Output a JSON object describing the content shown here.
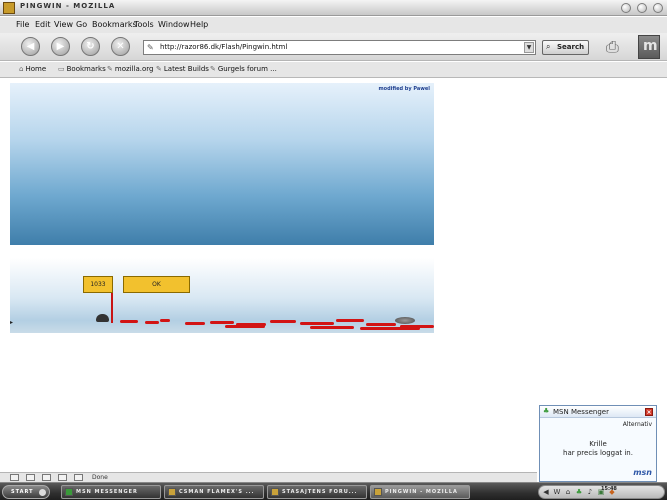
{
  "window": {
    "title": "Pingwin - Mozilla"
  },
  "menu": {
    "items": [
      "File",
      "Edit",
      "View",
      "Go",
      "Bookmarks",
      "Tools",
      "Window",
      "Help"
    ]
  },
  "navigation": {
    "back_icon": "back-arrow-icon",
    "forward_icon": "forward-arrow-icon",
    "reload_icon": "reload-icon",
    "stop_icon": "stop-icon",
    "url": "http://razor86.dk/Flash/Pingwin.html",
    "search_label": "Search"
  },
  "personal_toolbar": {
    "items": [
      "Home",
      "Bookmarks",
      "mozilla.org",
      "Latest Builds",
      "Gurgels forum ..."
    ]
  },
  "flash_game": {
    "credit": "modified by Pawel",
    "score": "1033",
    "ok_label": "OK"
  },
  "status_bar": {
    "status": "Done"
  },
  "msn_popup": {
    "title": "MSN Messenger",
    "alternativ": "Alternativ",
    "contact": "Krille",
    "message": "har precis loggat in.",
    "logo": "msn"
  },
  "taskbar": {
    "start": "START",
    "tasks": [
      "MSN MESSENGER",
      "CSMAN FLAMEX'S ...",
      "STASAJTENS FORU...",
      "PINGWIN - MOZILLA"
    ],
    "clock": "15:48"
  },
  "colors": {
    "blood": "#d21414",
    "sky_dark": "#3f7eaa",
    "button_yellow": "#f2c12e",
    "msn_border": "#6f8fb6"
  }
}
